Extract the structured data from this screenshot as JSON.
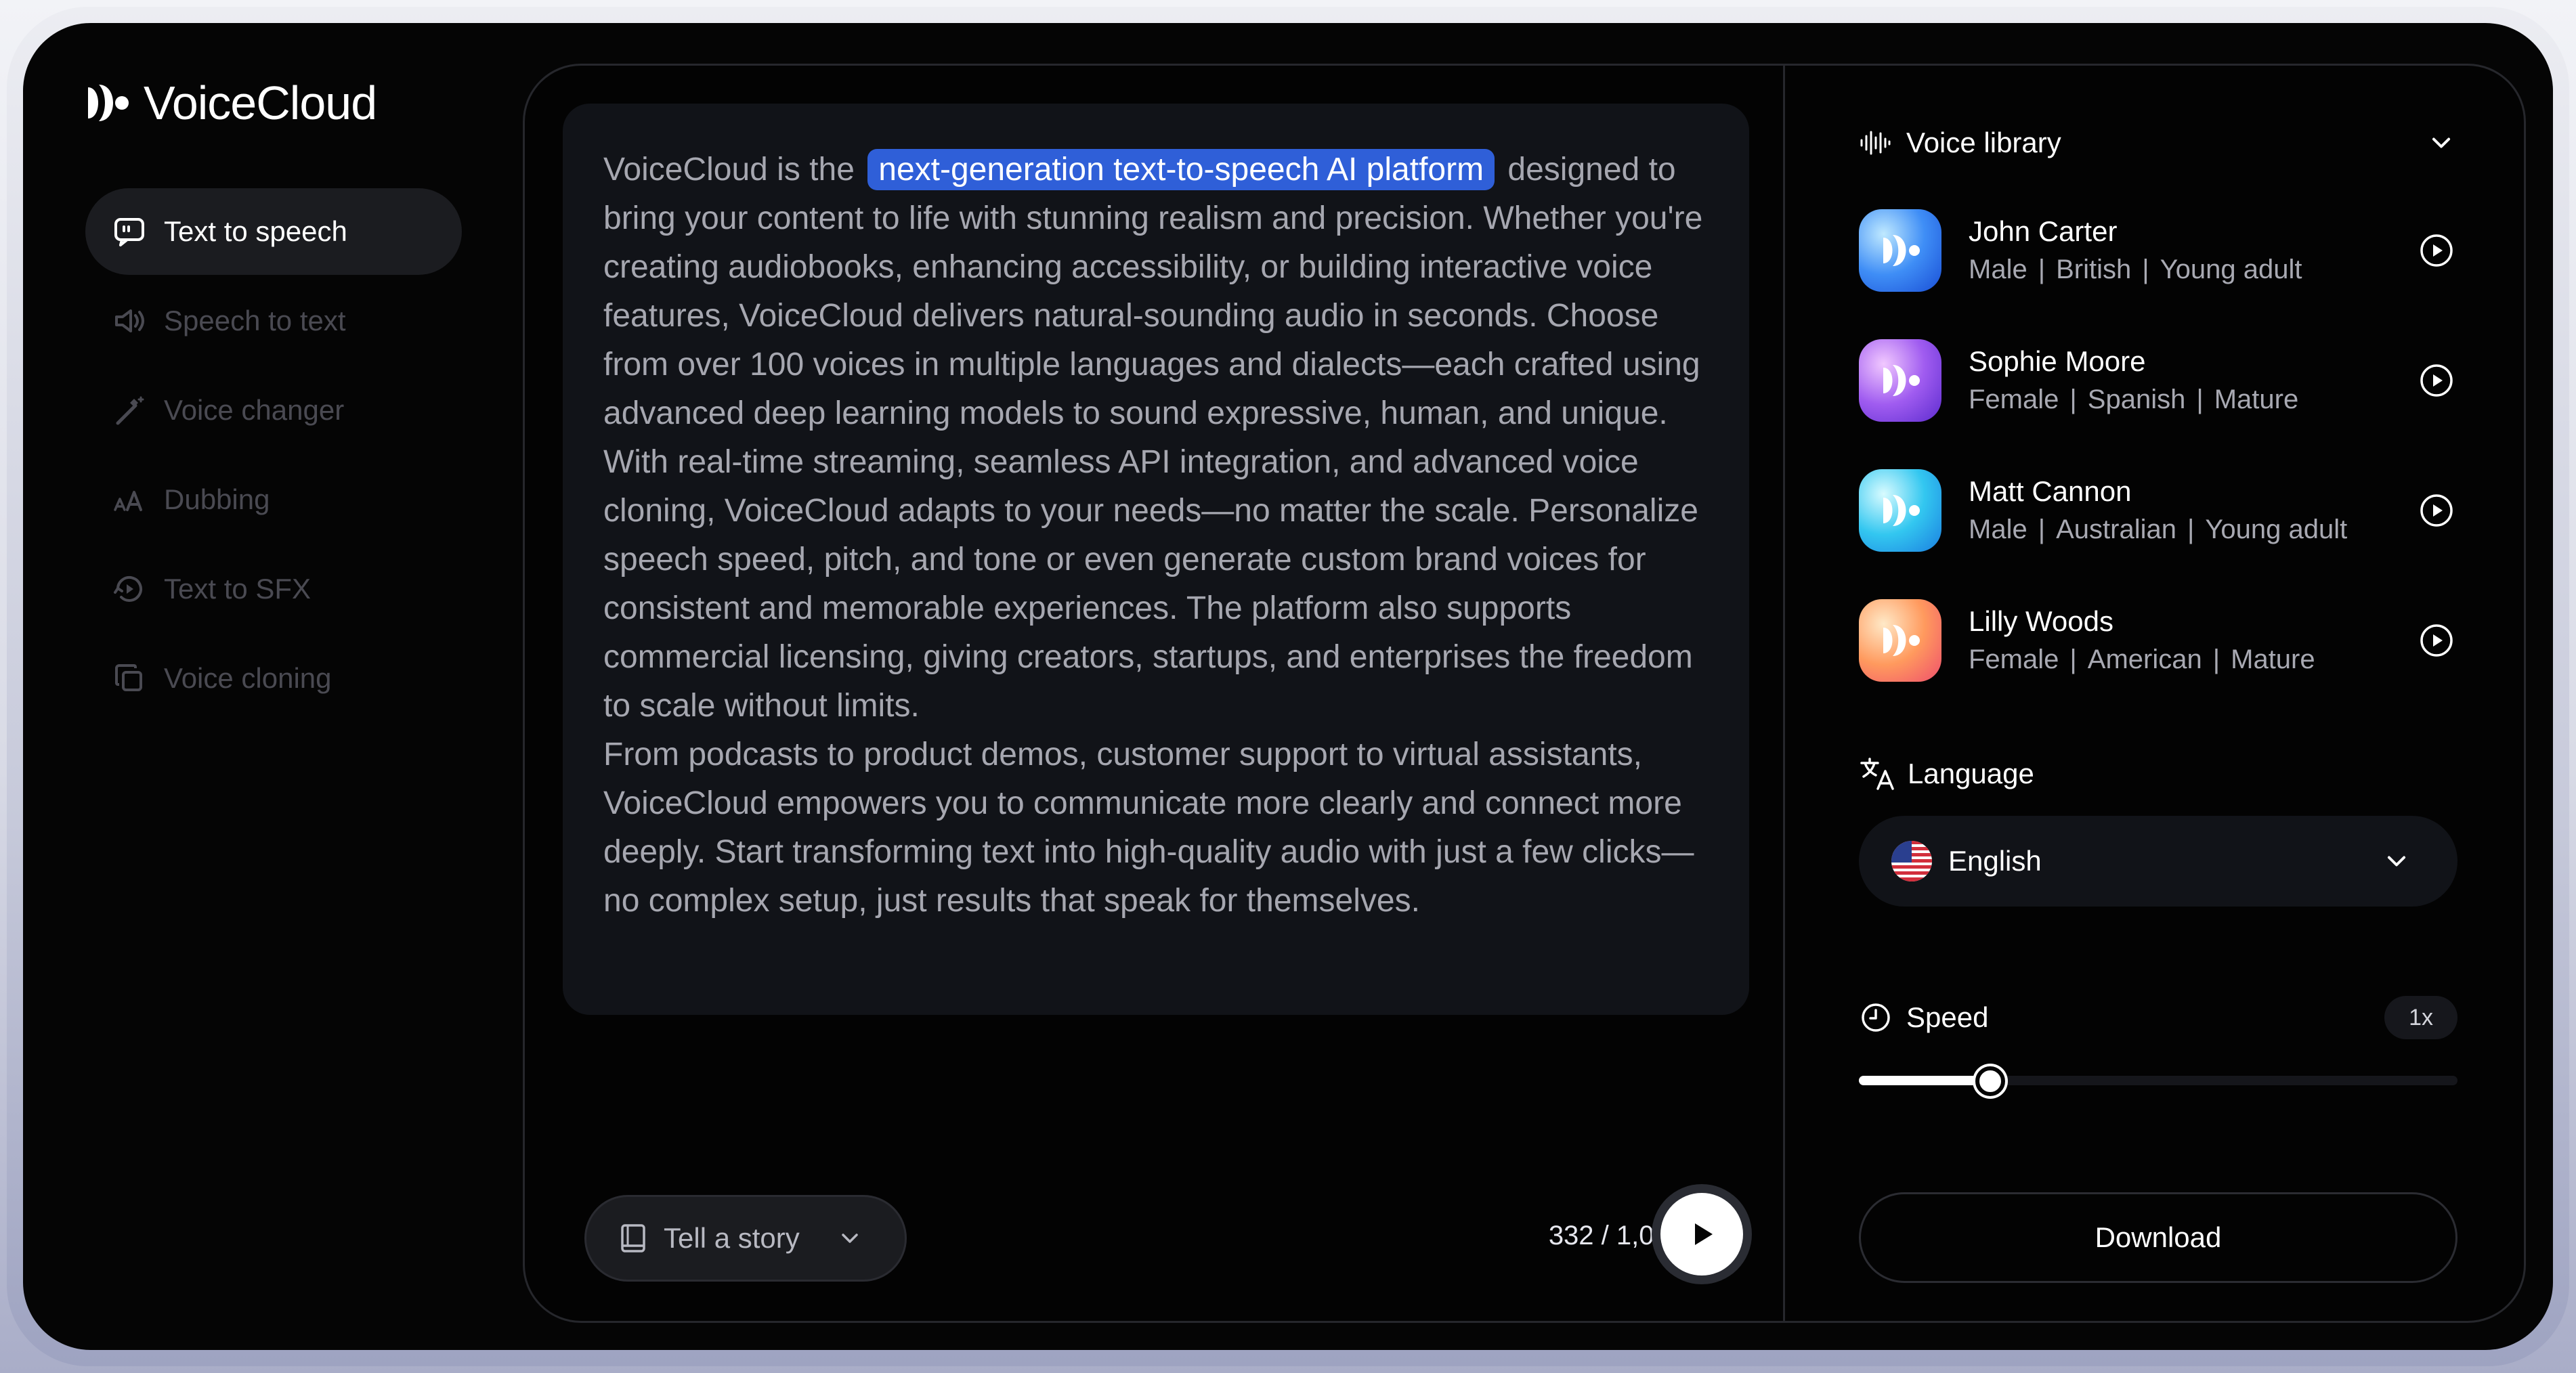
{
  "app": {
    "name": "VoiceCloud"
  },
  "sidebar": {
    "items": [
      {
        "label": "Text to speech",
        "icon": "chat-bubble-icon",
        "active": true
      },
      {
        "label": "Speech to text",
        "icon": "speaker-icon",
        "active": false
      },
      {
        "label": "Voice changer",
        "icon": "wand-icon",
        "active": false
      },
      {
        "label": "Dubbing",
        "icon": "font-size-icon",
        "active": false
      },
      {
        "label": "Text to SFX",
        "icon": "sfx-icon",
        "active": false
      },
      {
        "label": "Voice cloning",
        "icon": "copy-icon",
        "active": false
      }
    ]
  },
  "editor": {
    "intro_before": "VoiceCloud is the",
    "highlight": "next-generation text-to-speech AI platform",
    "intro_after": "designed to bring your content to life with stunning realism and precision. Whether you're creating audiobooks, enhancing accessibility, or building interactive voice features, VoiceCloud delivers natural-sounding audio in seconds. Choose from over 100 voices in multiple languages and dialects—each crafted using advanced deep learning models to sound expressive, human, and unique.",
    "paragraph2": "With real-time streaming, seamless API integration, and advanced voice cloning, VoiceCloud adapts to your needs—no matter the scale. Personalize speech speed, pitch, and tone or even generate custom brand voices for consistent and memorable experiences. The platform also supports commercial licensing, giving creators, startups, and enterprises the freedom to scale without limits.",
    "paragraph3": "From podcasts to product demos, customer support to virtual assistants, VoiceCloud empowers you to communicate more clearly and connect more deeply. Start transforming text into high-quality audio with just a few clicks—no complex setup, just results that speak for themselves."
  },
  "footer": {
    "story_label": "Tell a story",
    "char_count": "332 / 1,000"
  },
  "voice_library": {
    "title": "Voice library",
    "voices": [
      {
        "name": "John Carter",
        "gender": "Male",
        "accent": "British",
        "age": "Young adult"
      },
      {
        "name": "Sophie Moore",
        "gender": "Female",
        "accent": "Spanish",
        "age": "Mature"
      },
      {
        "name": "Matt Cannon",
        "gender": "Male",
        "accent": "Australian",
        "age": "Young adult"
      },
      {
        "name": "Lilly Woods",
        "gender": "Female",
        "accent": "American",
        "age": "Mature"
      }
    ],
    "separator": "|"
  },
  "language": {
    "title": "Language",
    "selected": "English"
  },
  "speed": {
    "title": "Speed",
    "value": "1x",
    "level": 0.22
  },
  "download_label": "Download",
  "colors": {
    "accent": "#2f5fd8",
    "background": "#050505"
  }
}
